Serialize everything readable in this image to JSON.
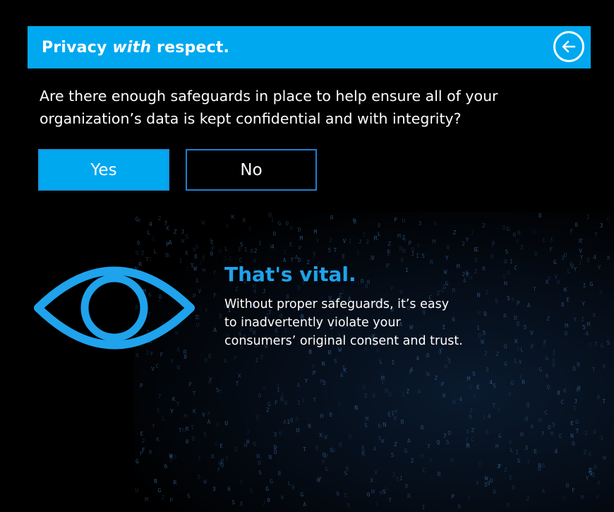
{
  "header": {
    "title_part1": "Privacy ",
    "title_em": "with",
    "title_part2": " respect.",
    "back_icon": "arrow-left-circle-icon"
  },
  "question": "Are there enough safeguards in place to help ensure all of your organization’s data is kept confidential and with integrity?",
  "answers": {
    "yes_label": "Yes",
    "no_label": "No"
  },
  "result": {
    "heading": "That's vital.",
    "body_lines": [
      "Without proper safeguards, it’s easy",
      "to inadvertently violate your",
      "consumers’ original consent and trust."
    ],
    "icon": "eye-icon"
  },
  "colors": {
    "accent": "#00a8f0",
    "heading_accent": "#1fa3ec",
    "background": "#000000"
  }
}
